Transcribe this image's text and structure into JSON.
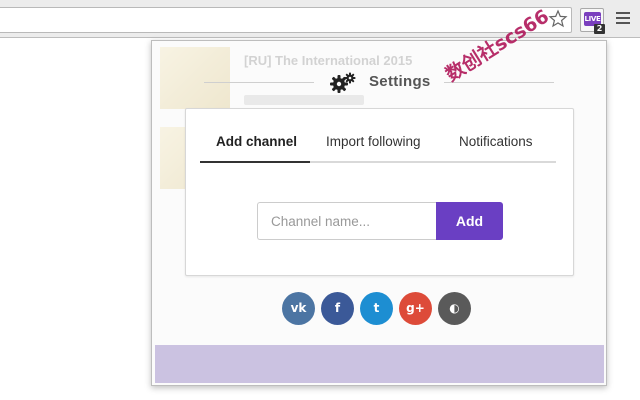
{
  "settings": {
    "title": "Settings"
  },
  "tabs": [
    {
      "label": "Add channel",
      "active": true
    },
    {
      "label": "Import following",
      "active": false
    },
    {
      "label": "Notifications",
      "active": false
    }
  ],
  "add_channel": {
    "placeholder": "Channel name...",
    "button_label": "Add"
  },
  "extension": {
    "logo_text": "LIVE",
    "badge": "2"
  },
  "background": {
    "stream_title": "[RU] The International 2015"
  },
  "social": [
    {
      "name": "vk",
      "glyph": "vk",
      "color": "#4c75a3"
    },
    {
      "name": "facebook",
      "glyph": "f",
      "color": "#3b5998"
    },
    {
      "name": "twitter",
      "glyph": "t",
      "color": "#1d8ed2"
    },
    {
      "name": "google-plus",
      "glyph": "g+",
      "color": "#dd4b39"
    },
    {
      "name": "github",
      "glyph": "◐",
      "color": "#5a5a5a"
    }
  ],
  "watermark": "数创社scs66",
  "colors": {
    "accent": "#6a3fc3"
  }
}
